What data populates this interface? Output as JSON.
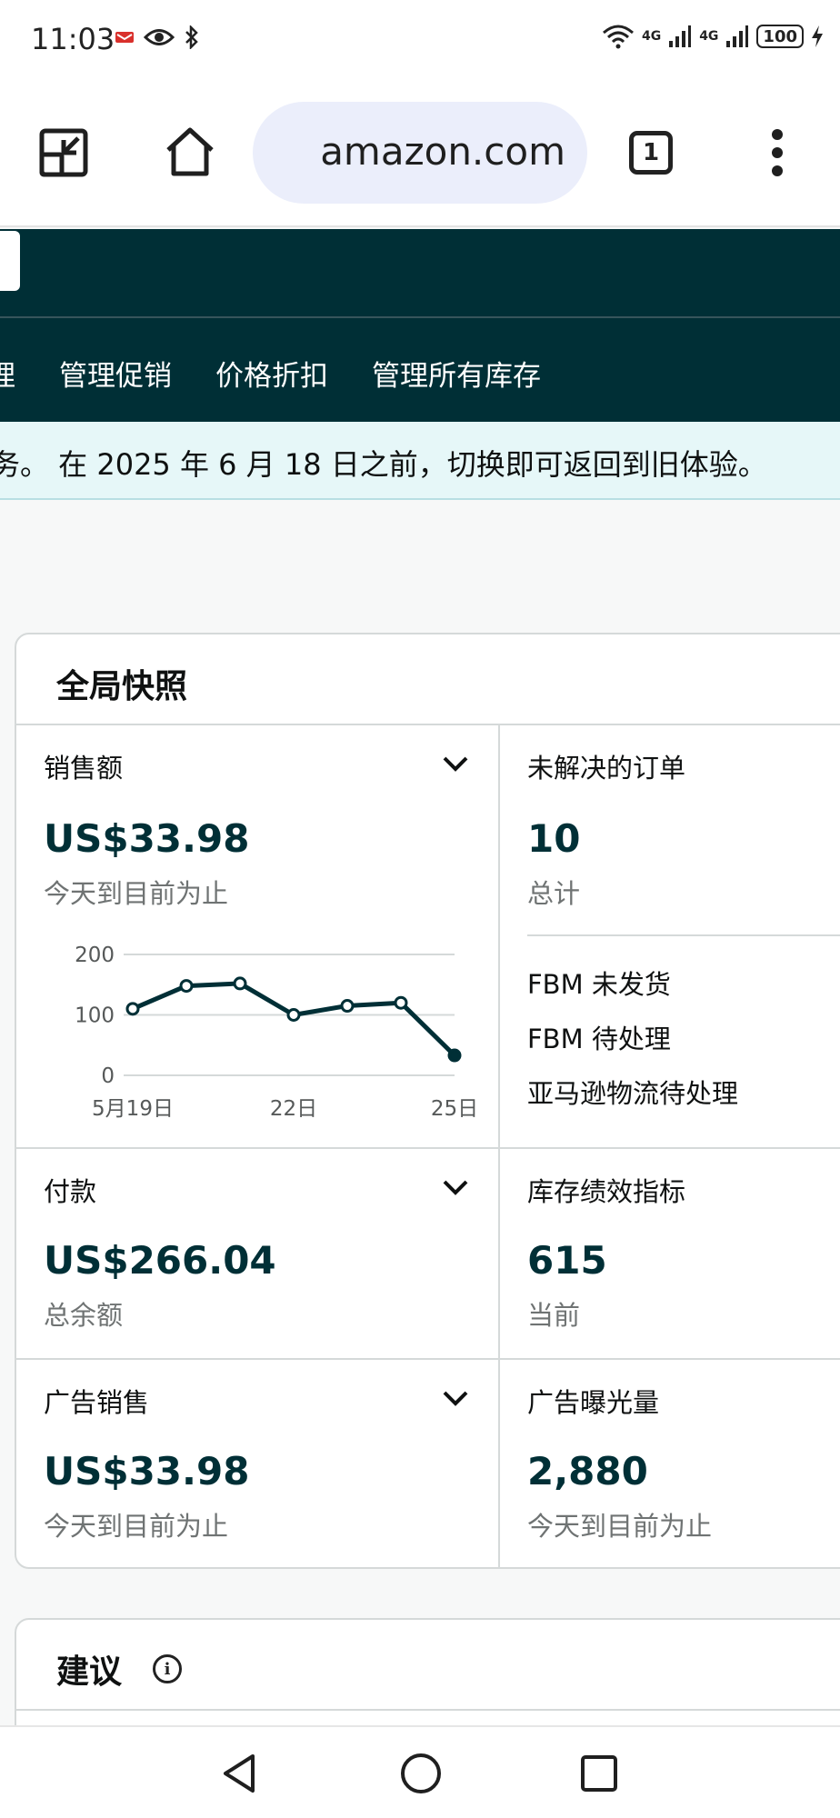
{
  "status_bar": {
    "time": "11:03",
    "signal_1": "4G",
    "signal_2": "4G",
    "battery": "100"
  },
  "browser": {
    "url": "amazon.com",
    "tab_count": "1"
  },
  "nav": {
    "items": [
      "理",
      "管理促销",
      "价格折扣",
      "管理所有库存"
    ]
  },
  "notice": {
    "text": "务。 在 2025 年 6 月 18 日之前，切换即可返回到旧体验。"
  },
  "snapshot": {
    "title": "全局快照",
    "sales": {
      "label": "销售额",
      "value": "US$33.98",
      "sub": "今天到目前为止"
    },
    "orders": {
      "label": "未解决的订单",
      "value": "10",
      "sub": "总计",
      "list": [
        "FBM 未发货",
        "FBM 待处理",
        "亚马逊物流待处理"
      ]
    },
    "payments": {
      "label": "付款",
      "value": "US$266.04",
      "sub": "总余额"
    },
    "inventory": {
      "label": "库存绩效指标",
      "value": "615",
      "sub": "当前"
    },
    "ad_sales": {
      "label": "广告销售",
      "value": "US$33.98",
      "sub": "今天到目前为止"
    },
    "ad_impressions": {
      "label": "广告曝光量",
      "value": "2,880",
      "sub": "今天到目前为止"
    }
  },
  "chart_data": {
    "type": "line",
    "x": [
      19,
      20,
      21,
      22,
      23,
      24,
      25
    ],
    "x_tick_labels": [
      "5月19日",
      "22日",
      "25日"
    ],
    "x_tick_values": [
      19,
      22,
      25
    ],
    "y_tick_labels": [
      "200",
      "100",
      "0"
    ],
    "y_tick_values": [
      200,
      100,
      0
    ],
    "ylim": [
      0,
      200
    ],
    "series": [
      {
        "values": [
          110,
          148,
          152,
          100,
          115,
          120,
          33
        ]
      }
    ],
    "grid": true,
    "line_color": "#002f36"
  },
  "suggest": {
    "title": "建议"
  }
}
